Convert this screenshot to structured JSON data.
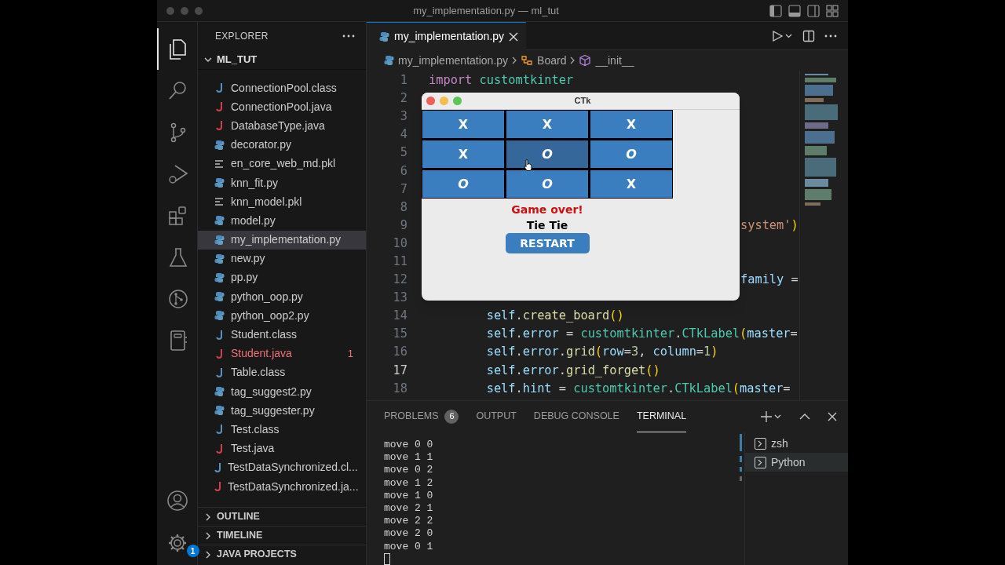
{
  "window": {
    "title": "my_implementation.py — ml_tut"
  },
  "activity_bar": [
    {
      "kind": "files",
      "selected": true
    },
    {
      "kind": "search",
      "selected": false
    },
    {
      "kind": "source-control",
      "selected": false
    },
    {
      "kind": "debug",
      "selected": false
    },
    {
      "kind": "extensions",
      "selected": false
    },
    {
      "kind": "flask",
      "selected": false
    },
    {
      "kind": "graph",
      "selected": false
    },
    {
      "kind": "notebook",
      "selected": false
    }
  ],
  "settings_badge": "1",
  "sidebar": {
    "title": "EXPLORER",
    "folder": "ML_TUT",
    "expanded": true,
    "files": [
      {
        "name": "ConnectionPool.class",
        "kind": "class",
        "selected": false,
        "error": false
      },
      {
        "name": "ConnectionPool.java",
        "kind": "java",
        "selected": false,
        "error": false
      },
      {
        "name": "DatabaseType.java",
        "kind": "java",
        "selected": false,
        "error": false
      },
      {
        "name": "decorator.py",
        "kind": "python",
        "selected": false,
        "error": false
      },
      {
        "name": "en_core_web_md.pkl",
        "kind": "pkl",
        "selected": false,
        "error": false
      },
      {
        "name": "knn_fit.py",
        "kind": "python",
        "selected": false,
        "error": false
      },
      {
        "name": "knn_model.pkl",
        "kind": "pkl",
        "selected": false,
        "error": false
      },
      {
        "name": "model.py",
        "kind": "python",
        "selected": false,
        "error": false
      },
      {
        "name": "my_implementation.py",
        "kind": "python",
        "selected": true,
        "error": false
      },
      {
        "name": "new.py",
        "kind": "python",
        "selected": false,
        "error": false
      },
      {
        "name": "pp.py",
        "kind": "python",
        "selected": false,
        "error": false
      },
      {
        "name": "python_oop.py",
        "kind": "python",
        "selected": false,
        "error": false
      },
      {
        "name": "python_oop2.py",
        "kind": "python",
        "selected": false,
        "error": false
      },
      {
        "name": "Student.class",
        "kind": "class",
        "selected": false,
        "error": false
      },
      {
        "name": "Student.java",
        "kind": "java",
        "selected": false,
        "error": true,
        "badge": "1"
      },
      {
        "name": "Table.class",
        "kind": "class",
        "selected": false,
        "error": false
      },
      {
        "name": "tag_suggest2.py",
        "kind": "python",
        "selected": false,
        "error": false
      },
      {
        "name": "tag_suggester.py",
        "kind": "python",
        "selected": false,
        "error": false
      },
      {
        "name": "Test.class",
        "kind": "class",
        "selected": false,
        "error": false
      },
      {
        "name": "Test.java",
        "kind": "java",
        "selected": false,
        "error": false
      },
      {
        "name": "TestDataSynchronized.cl...",
        "kind": "class",
        "selected": false,
        "error": false
      },
      {
        "name": "TestDataSynchronized.ja...",
        "kind": "java",
        "selected": false,
        "error": false
      }
    ],
    "sections": [
      {
        "label": "OUTLINE",
        "expanded": false
      },
      {
        "label": "TIMELINE",
        "expanded": false
      },
      {
        "label": "JAVA PROJECTS",
        "expanded": false
      }
    ]
  },
  "editor": {
    "tab": {
      "label": "my_implementation.py",
      "selected": true
    },
    "breadcrumb": [
      {
        "kind": "file",
        "label": "my_implementation.py"
      },
      {
        "kind": "class",
        "label": "Board"
      },
      {
        "kind": "method",
        "label": "__init__"
      }
    ],
    "lines": [
      {
        "number": "1",
        "current": false,
        "tokens": [
          {
            "kind": "keyword",
            "text": "import"
          },
          {
            "kind": "module",
            "text": " customtkinter"
          }
        ]
      },
      {
        "number": "2",
        "current": false
      },
      {
        "number": "3",
        "current": false
      },
      {
        "number": "4",
        "current": false
      },
      {
        "number": "5",
        "current": false
      },
      {
        "number": "6",
        "current": false
      },
      {
        "number": "7",
        "current": false
      },
      {
        "number": "8",
        "current": false
      },
      {
        "number": "9",
        "current": false,
        "partly_hidden": true,
        "tokens": [
          {
            "kind": "string",
            "text": "system'"
          },
          {
            "kind": "bracket",
            "text": ")"
          }
        ]
      },
      {
        "number": "10",
        "current": false
      },
      {
        "number": "11",
        "current": false
      },
      {
        "number": "12",
        "current": false,
        "partly_hidden": true,
        "tokens": [
          {
            "kind": "var",
            "text": "family"
          },
          {
            "kind": "plain",
            "text": " ="
          }
        ]
      },
      {
        "number": "13",
        "current": false
      },
      {
        "number": "14",
        "current": false,
        "tokens": [
          {
            "kind": "var",
            "text": "        self"
          },
          {
            "kind": "plain",
            "text": "."
          },
          {
            "kind": "func",
            "text": "create_board"
          },
          {
            "kind": "bracket",
            "text": "()"
          }
        ]
      },
      {
        "number": "15",
        "current": false,
        "tokens": [
          {
            "kind": "var",
            "text": "        self"
          },
          {
            "kind": "plain",
            "text": "."
          },
          {
            "kind": "var",
            "text": "error"
          },
          {
            "kind": "plain",
            "text": " = "
          },
          {
            "kind": "module",
            "text": "customtkinter"
          },
          {
            "kind": "plain",
            "text": "."
          },
          {
            "kind": "module",
            "text": "CTkLabel"
          },
          {
            "kind": "bracket",
            "text": "("
          },
          {
            "kind": "var",
            "text": "master"
          },
          {
            "kind": "plain",
            "text": "="
          }
        ]
      },
      {
        "number": "16",
        "current": false,
        "tokens": [
          {
            "kind": "var",
            "text": "        self"
          },
          {
            "kind": "plain",
            "text": "."
          },
          {
            "kind": "var",
            "text": "error"
          },
          {
            "kind": "plain",
            "text": "."
          },
          {
            "kind": "func",
            "text": "grid"
          },
          {
            "kind": "bracket",
            "text": "("
          },
          {
            "kind": "var",
            "text": "row"
          },
          {
            "kind": "plain",
            "text": "="
          },
          {
            "kind": "number",
            "text": "3"
          },
          {
            "kind": "plain",
            "text": ", "
          },
          {
            "kind": "var",
            "text": "column"
          },
          {
            "kind": "plain",
            "text": "="
          },
          {
            "kind": "number",
            "text": "1"
          },
          {
            "kind": "bracket",
            "text": ")"
          }
        ]
      },
      {
        "number": "17",
        "current": true,
        "tokens": [
          {
            "kind": "var",
            "text": "        self"
          },
          {
            "kind": "plain",
            "text": "."
          },
          {
            "kind": "var",
            "text": "error"
          },
          {
            "kind": "plain",
            "text": "."
          },
          {
            "kind": "func",
            "text": "grid_forget"
          },
          {
            "kind": "bracket",
            "text": "()"
          }
        ]
      },
      {
        "number": "18",
        "current": false,
        "tokens": [
          {
            "kind": "var",
            "text": "        self"
          },
          {
            "kind": "plain",
            "text": "."
          },
          {
            "kind": "var",
            "text": "hint"
          },
          {
            "kind": "plain",
            "text": " = "
          },
          {
            "kind": "module",
            "text": "customtkinter"
          },
          {
            "kind": "plain",
            "text": "."
          },
          {
            "kind": "module",
            "text": "CTkLabel"
          },
          {
            "kind": "bracket",
            "text": "("
          },
          {
            "kind": "var",
            "text": "master"
          },
          {
            "kind": "plain",
            "text": "="
          }
        ]
      }
    ]
  },
  "ctk_window": {
    "title": "CTk",
    "cells": [
      {
        "mark": "X",
        "hovered": false
      },
      {
        "mark": "X",
        "hovered": false
      },
      {
        "mark": "X",
        "hovered": false
      },
      {
        "mark": "X",
        "hovered": false
      },
      {
        "mark": "O",
        "hovered": true
      },
      {
        "mark": "O",
        "hovered": false
      },
      {
        "mark": "O",
        "hovered": false
      },
      {
        "mark": "O",
        "hovered": false
      },
      {
        "mark": "X",
        "hovered": false
      }
    ],
    "status": "Game over!",
    "result": "Tie Tie",
    "button": "RESTART"
  },
  "panel": {
    "tabs": [
      {
        "label": "PROBLEMS",
        "badge": "6",
        "selected": false
      },
      {
        "label": "OUTPUT",
        "selected": false
      },
      {
        "label": "DEBUG CONSOLE",
        "selected": false
      },
      {
        "label": "TERMINAL",
        "selected": true
      }
    ],
    "terminal_lines": [
      "move 0 0",
      "move 1 1",
      "move 0 2",
      "move 1 2",
      "move 1 0",
      "move 2 1",
      "move 2 2",
      "move 2 0",
      "move 0 1"
    ],
    "terminals": [
      {
        "label": "zsh",
        "selected": false
      },
      {
        "label": "Python",
        "selected": true
      }
    ]
  }
}
